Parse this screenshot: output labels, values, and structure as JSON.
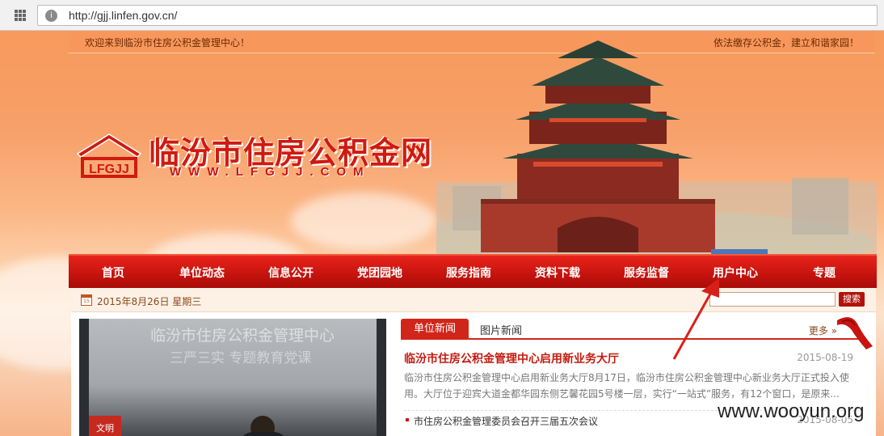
{
  "browser": {
    "url": "http://gjj.linfen.gov.cn/"
  },
  "header": {
    "welcome_left": "欢迎来到临汾市住房公积金管理中心！",
    "welcome_right": "依法缴存公积金，建立和谐家园！",
    "site_title": "临汾市住房公积金网",
    "site_domain": "WWW.LFGJJ.COM",
    "logo_text": "LFGJJ"
  },
  "nav": {
    "items": [
      {
        "label": "首页"
      },
      {
        "label": "单位动态"
      },
      {
        "label": "信息公开"
      },
      {
        "label": "党团园地"
      },
      {
        "label": "服务指南"
      },
      {
        "label": "资料下载"
      },
      {
        "label": "服务监督"
      },
      {
        "label": "用户中心"
      },
      {
        "label": "专题"
      }
    ]
  },
  "date_bar": {
    "date": "2015年8月26日 星期三",
    "search_placeholder": "",
    "search_label": "搜索"
  },
  "photo": {
    "caption1": "临汾市住房公积金管理中心",
    "caption2": "三严三实 专题教育党课",
    "banner": "文明"
  },
  "news": {
    "tab_active": "单位新闻",
    "tab_inactive": "图片新闻",
    "more": "更多",
    "headline": "临汾市住房公积金管理中心启用新业务大厅",
    "headline_date": "2015-08-19",
    "summary": "临汾市住房公积金管理中心启用新业务大厅8月17日，临汾市住房公积金管理中心新业务大厅正式投入使用。大厅位于迎宾大道金都华园东侧艺馨花园5号楼一层，实行“一站式”服务，有12个窗口，是原来...",
    "items": [
      {
        "title": "市住房公积金管理委员会召开三届五次会议",
        "date": "2015-08-05"
      }
    ]
  },
  "overlay": {
    "watermark": "www.wooyun.org"
  },
  "colors": {
    "nav_red": "#c8140f",
    "headline_red": "#c21c10",
    "page_orange": "#f79a5c"
  }
}
